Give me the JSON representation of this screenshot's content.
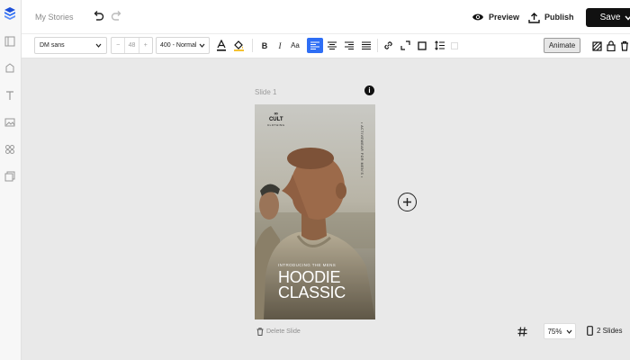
{
  "app": {
    "project_name": "My Stories"
  },
  "header": {
    "preview_label": "Preview",
    "publish_label": "Publish",
    "save_label": "Save"
  },
  "toolbar": {
    "font_family": "DM sans",
    "font_size": "48",
    "font_weight": "400 - Normal",
    "bold": "B",
    "italic": "I",
    "text_case": "Aa",
    "text_align": "left",
    "animate_label": "Animate"
  },
  "canvas": {
    "slide_label": "Slide 1",
    "delete_label": "Delete Slide",
    "slide_content": {
      "brand_name": "CULT",
      "brand_sub": "CLOTHING",
      "vertical_text": "• ACTIVEWEAR FOR MEN'S •",
      "intro_text": "INTRODUCING THE MENS",
      "headline_line1": "HOODIE",
      "headline_line2": "CLASSIC"
    }
  },
  "footer": {
    "zoom": "75%",
    "slide_count": "2 Slides"
  },
  "colors": {
    "accent": "#2e6ef5",
    "save_bg": "#111111",
    "canvas_bg": "#e9e9e9"
  }
}
